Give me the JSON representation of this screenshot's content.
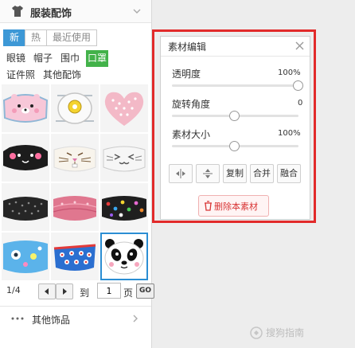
{
  "left_panel": {
    "title": "服装配饰",
    "tabs": [
      {
        "label": "新",
        "active": true
      },
      {
        "label": "热",
        "active": false
      },
      {
        "label": "最近使用",
        "active": false
      }
    ],
    "categories": [
      {
        "label": "眼镜",
        "active": false
      },
      {
        "label": "帽子",
        "active": false
      },
      {
        "label": "围巾",
        "active": false
      },
      {
        "label": "口罩",
        "active": true
      },
      {
        "label": "证件照",
        "active": false
      },
      {
        "label": "其他配饰",
        "active": false
      }
    ],
    "items": [
      {
        "name": "bear-face-mask"
      },
      {
        "name": "n95-valve-mask"
      },
      {
        "name": "pink-floral-mask"
      },
      {
        "name": "black-cute-mask"
      },
      {
        "name": "rabbit-face-mask"
      },
      {
        "name": "cat-face-mask"
      },
      {
        "name": "black-sequin-mask"
      },
      {
        "name": "pink-patterned-mask"
      },
      {
        "name": "black-polka-dot-mask"
      },
      {
        "name": "blue-cartoon-mask"
      },
      {
        "name": "blue-eyeball-mask"
      },
      {
        "name": "panda-mask",
        "selected": true
      }
    ],
    "pagination": {
      "count": "1/4",
      "goto_label": "到",
      "page_value": "1",
      "page_suffix": "页",
      "go_label": "GO"
    },
    "footer": {
      "label": "其他饰品"
    }
  },
  "editor": {
    "title": "素材编辑",
    "properties": [
      {
        "label": "透明度",
        "value": "100%",
        "fraction": 1.0
      },
      {
        "label": "旋转角度",
        "value": "0",
        "fraction": 0.5
      },
      {
        "label": "素材大小",
        "value": "100%",
        "fraction": 0.5
      }
    ],
    "tools": {
      "flip_horizontal_icon": "flip-horizontal-icon",
      "flip_vertical_icon": "flip-vertical-icon",
      "copy": "复制",
      "merge": "合并",
      "blend": "融合"
    },
    "delete_label": "删除本素材"
  },
  "watermark": {
    "text": "搜狗指南"
  },
  "colors": {
    "accent_blue": "#3d98d6",
    "category_active_green": "#43b24a",
    "highlight_red": "#e22a2a",
    "delete_red": "#d83434",
    "selection_blue": "#2b8ed3"
  }
}
